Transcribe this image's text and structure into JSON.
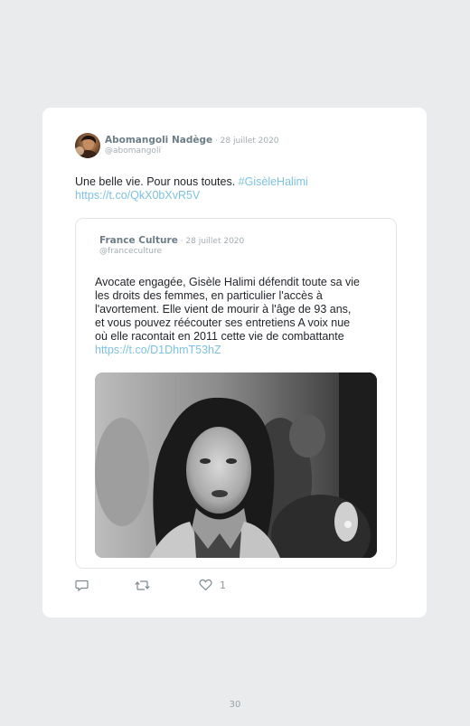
{
  "tweet": {
    "author_name": "Abomangoli Nadège",
    "date": " · 28 juillet 2020",
    "handle": "@abomangoli",
    "text": "Une belle vie. Pour nous toutes. ",
    "hashtag": "#GisèleHalimi",
    "link": "https://t.co/QkX0bXvR5V"
  },
  "quoted": {
    "author_name": "France Culture",
    "date": " · 28 juillet 2020",
    "handle": "@franceculture",
    "lines": [
      "Avocate engagée, Gisèle Halimi défendit toute sa vie",
      "les droits des femmes, en particulier l'accès à",
      "l'avortement. Elle vient de mourir à l'âge de 93 ans,",
      "et vous pouvez réécouter ses entretiens A voix nue",
      "où elle racontait en 2011 cette vie de combattante"
    ],
    "link": "https://t.co/D1DhmT53hZ",
    "photo_alt": "Black-and-white photo of Gisèle Halimi speaking"
  },
  "actions": {
    "reply_icon": "reply-icon",
    "retweet_icon": "retweet-icon",
    "like_icon": "heart-icon",
    "like_count": "1"
  },
  "page_number": "30"
}
